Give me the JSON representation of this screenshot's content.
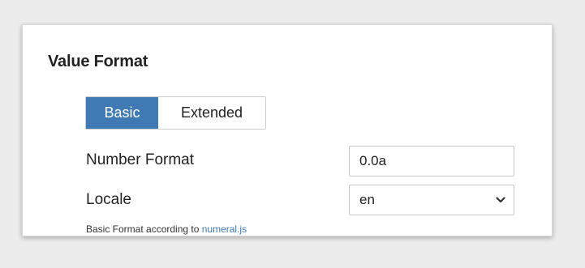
{
  "panel": {
    "title": "Value Format"
  },
  "format_toggle": {
    "options": [
      "Basic",
      "Extended"
    ],
    "selected": "Basic"
  },
  "number_format": {
    "label": "Number Format",
    "value": "0.0a"
  },
  "locale": {
    "label": "Locale",
    "value": "en",
    "icon": "chevron-down-icon"
  },
  "note": {
    "text": "Basic Format according to ",
    "link_text": "numeral.js"
  },
  "colors": {
    "accent": "#3f7ab4",
    "background": "#ececec",
    "panel": "#ffffff"
  }
}
